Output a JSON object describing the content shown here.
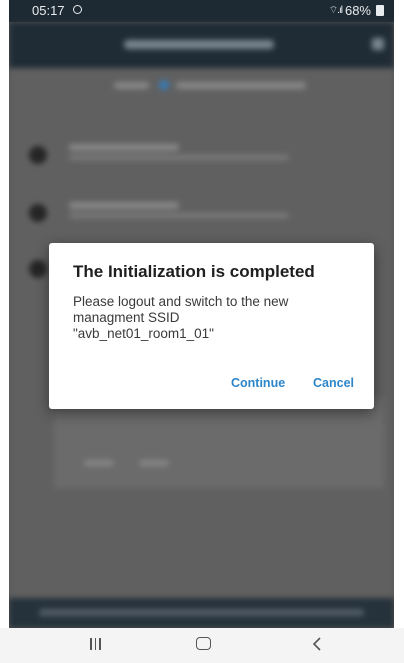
{
  "status_bar": {
    "time": "05:17",
    "battery": "68%",
    "icons": [
      "clock-icon",
      "wifi-icon",
      "signal-icon",
      "battery-icon"
    ]
  },
  "dialog": {
    "title": "The Initialization is completed",
    "message": "Please logout and switch to the new\nmanagment SSID\n\"avb_net01_room1_01\"",
    "continue_label": "Continue",
    "cancel_label": "Cancel"
  },
  "nav_bar": {
    "icons": [
      "recents-icon",
      "home-icon",
      "back-icon"
    ]
  },
  "colors": {
    "accent": "#2e86c9",
    "header": "#24323d",
    "dialog_bg": "#ffffff"
  }
}
